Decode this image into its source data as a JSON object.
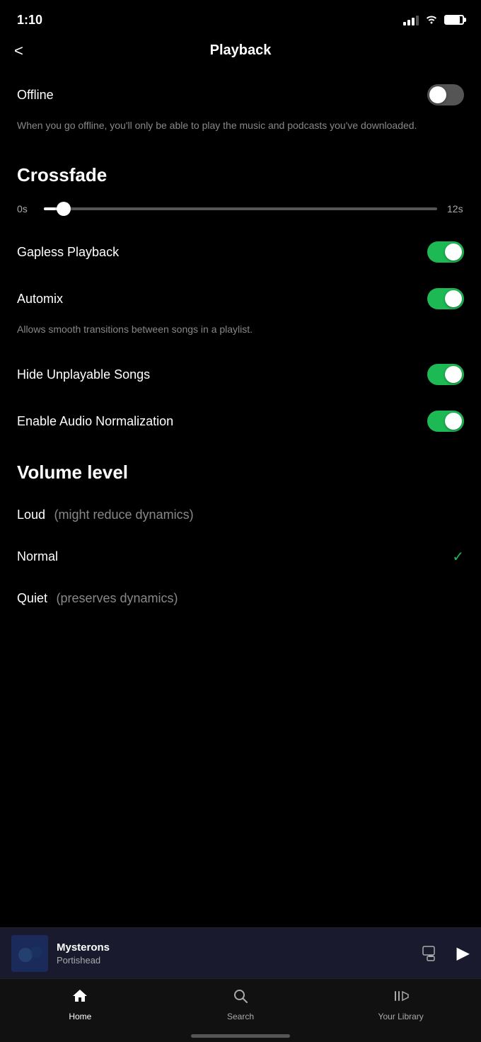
{
  "statusBar": {
    "time": "1:10"
  },
  "header": {
    "backLabel": "<",
    "title": "Playback"
  },
  "settings": {
    "offlineLabel": "Offline",
    "offlineDescription": "When you go offline, you'll only be able to play the music and podcasts you've downloaded.",
    "offlineToggle": "off",
    "crossfadeHeader": "Crossfade",
    "sliderMin": "0s",
    "sliderMax": "12s",
    "gaplessPlaybackLabel": "Gapless Playback",
    "gaplessToggle": "on",
    "automixLabel": "Automix",
    "automixToggle": "on",
    "automixDescription": "Allows smooth transitions between songs in a playlist.",
    "hideUnplayableLabel": "Hide Unplayable Songs",
    "hideUnplayableToggle": "on",
    "audioNormalizationLabel": "Enable Audio Normalization",
    "audioNormalizationToggle": "on",
    "volumeLevelHeader": "Volume level",
    "volumeLoud": "Loud",
    "volumeLoudSub": "(might reduce dynamics)",
    "volumeNormal": "Normal",
    "volumeQuiet": "Quiet",
    "volumeQuietSub": "(preserves dynamics)"
  },
  "nowPlaying": {
    "trackName": "Mysterons",
    "artistName": "Portishead"
  },
  "bottomNav": {
    "homeLabel": "Home",
    "searchLabel": "Search",
    "libraryLabel": "Your Library"
  }
}
